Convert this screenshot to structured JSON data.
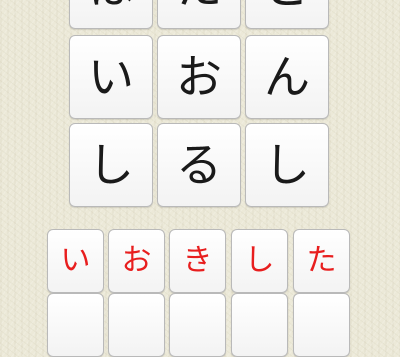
{
  "board": {
    "tiles": [
      {
        "char": "は"
      },
      {
        "char": "た"
      },
      {
        "char": "ど"
      },
      {
        "char": "い"
      },
      {
        "char": "お"
      },
      {
        "char": "ん"
      },
      {
        "char": "し"
      },
      {
        "char": "る"
      },
      {
        "char": "し"
      }
    ]
  },
  "answer": {
    "tiles": [
      {
        "char": "い"
      },
      {
        "char": "お"
      },
      {
        "char": "き"
      },
      {
        "char": "し"
      },
      {
        "char": "た"
      },
      {
        "char": ""
      },
      {
        "char": ""
      },
      {
        "char": ""
      },
      {
        "char": ""
      },
      {
        "char": ""
      }
    ]
  },
  "colors": {
    "background": "#ece9d8",
    "tile": "#ffffff",
    "tile_border": "#b9b9b9",
    "board_text": "#1a1a1a",
    "answer_text": "#e81e1e"
  }
}
